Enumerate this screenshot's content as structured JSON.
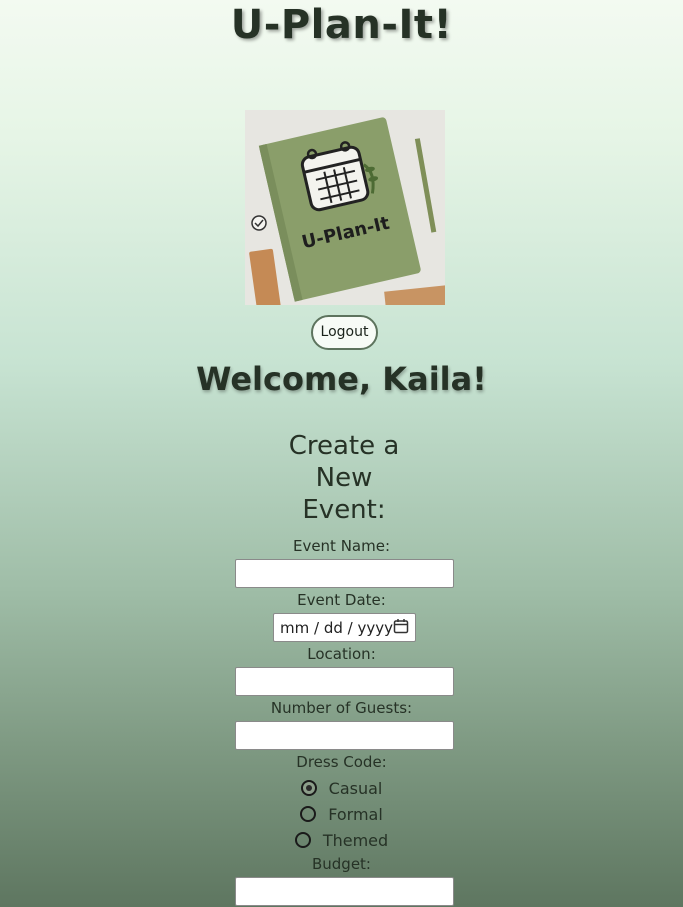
{
  "app": {
    "title": "U-Plan-It!"
  },
  "logo": {
    "alt_text": "U-Plan-It",
    "accent": "#8a9e6a"
  },
  "header": {
    "logout_label": "Logout"
  },
  "welcome": "Welcome, Kaila!",
  "form": {
    "heading_lines": [
      "Create a",
      "New",
      "Event:"
    ],
    "event_name": {
      "label": "Event Name:",
      "value": ""
    },
    "event_date": {
      "label": "Event Date:",
      "placeholder": "mm / dd / yyyy"
    },
    "location": {
      "label": "Location:",
      "value": ""
    },
    "guests": {
      "label": "Number of Guests:",
      "value": ""
    },
    "dress_code": {
      "label": "Dress Code:",
      "options": [
        "Casual",
        "Formal",
        "Themed"
      ],
      "selected": "Casual"
    },
    "budget": {
      "label": "Budget:",
      "value": ""
    }
  },
  "colors": {
    "text": "#263226",
    "button_border": "#5d735d"
  }
}
